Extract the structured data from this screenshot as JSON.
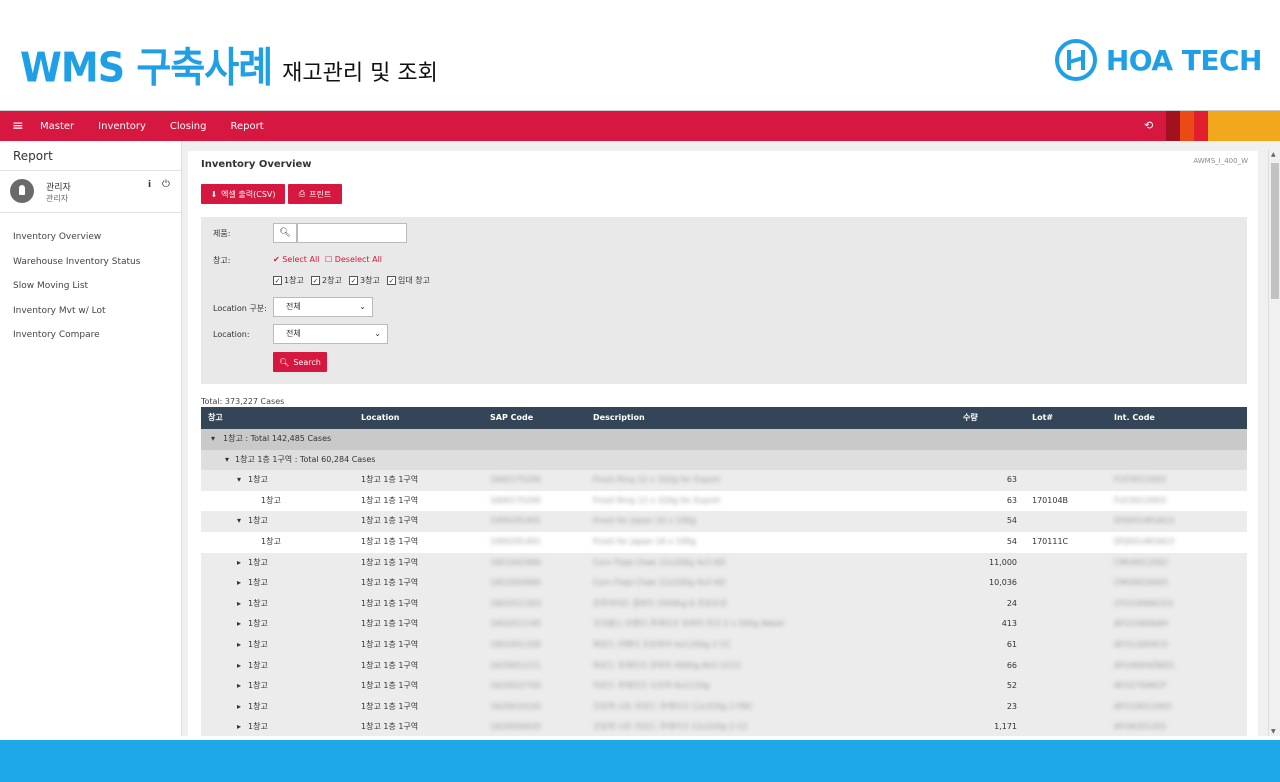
{
  "slide": {
    "title_main": "WMS 구축사례",
    "title_sub": "재고관리 및 조회",
    "logo_text": "HOA TECH",
    "accent": "#1e9fe6"
  },
  "topbar": {
    "menu_icon": "hamburger-icon",
    "nav": [
      "Master",
      "Inventory",
      "Closing",
      "Report"
    ],
    "color": "#d6173f"
  },
  "sidebar": {
    "title": "Report",
    "user_name": "관리자",
    "user_role": "관리자",
    "items": [
      "Inventory Overview",
      "Warehouse Inventory Status",
      "Slow Moving List",
      "Inventory Mvt w/ Lot",
      "Inventory Compare"
    ]
  },
  "content": {
    "title": "Inventory Overview",
    "code": "AWMS_I_400_W",
    "btn_csv": "엑셀 출력(CSV)",
    "btn_print": "프린트"
  },
  "filter": {
    "product_label": "제품:",
    "warehouse_label": "창고:",
    "select_all": "Select All",
    "deselect_all": "Deselect All",
    "warehouses": [
      "1창고",
      "2창고",
      "3창고",
      "임대 창고"
    ],
    "loc_type_label": "Location 구분:",
    "loc_type_value": "전체",
    "location_label": "Location:",
    "location_value": "전체",
    "search_btn": "Search"
  },
  "table": {
    "total": "Total: 373,227 Cases",
    "headers": [
      "창고",
      "Location",
      "SAP Code",
      "Description",
      "수량",
      "Lot#",
      "Int. Code"
    ],
    "group1": "1창고 : Total 142,485 Cases",
    "group2": "1창고 1층 1구역 : Total 60,284 Cases",
    "rows": [
      {
        "wh": "1창고",
        "loc": "1창고 1층 1구역",
        "sap": "1600175200",
        "desc": "Frosti Ring 12 x 320g for Export",
        "qty": "63",
        "lot": "",
        "int": "FUC0012003",
        "kind": "expanded"
      },
      {
        "wh": "1창고",
        "loc": "1창고 1층 1구역",
        "sap": "1600175200",
        "desc": "Frosti Ring 12 x 320g for Export",
        "qty": "63",
        "lot": "170104B",
        "int": "FUC0012003",
        "kind": "detail"
      },
      {
        "wh": "1창고",
        "loc": "1창고 1층 1구역",
        "sap": "1000291401",
        "desc": "Frosti for Japan 16 x 100g",
        "qty": "54",
        "lot": "",
        "int": "DFJ0014816G3",
        "kind": "expanded"
      },
      {
        "wh": "1창고",
        "loc": "1창고 1층 1구역",
        "sap": "1000291401",
        "desc": "Frosti for Japan 16 x 100g",
        "qty": "54",
        "lot": "170111C",
        "int": "DFJ0014816G3",
        "kind": "detail"
      },
      {
        "wh": "1창고",
        "loc": "1창고 1층 1구역",
        "sap": "1651042900",
        "desc": "Corn Flaje Chee 12x200g 4x3 KD",
        "qty": "11,000",
        "lot": "",
        "int": "CMU0012002",
        "kind": "collapsed"
      },
      {
        "wh": "1창고",
        "loc": "1창고 1층 1구역",
        "sap": "1651050900",
        "desc": "Corn Flaje Chee 12x200g 4x3 KD",
        "qty": "10,036",
        "lot": "",
        "int": "CMU0010002",
        "kind": "collapsed"
      },
      {
        "wh": "1창고",
        "loc": "1창고 1층 1구역",
        "sap": "1602011303",
        "desc": "콘푸라이트 링바이 3300kg 6 프로모션",
        "qty": "24",
        "lot": "",
        "int": "CFO10066CO3",
        "kind": "collapsed"
      },
      {
        "wh": "1창고",
        "loc": "1창고 1층 1구역",
        "sap": "1602011145",
        "desc": "코코팝스 라벤더 후레이크 포바이 미국 5 x 500g Retail",
        "qty": "413",
        "lot": "",
        "int": "AFO1S00AAH",
        "kind": "collapsed"
      },
      {
        "wh": "1창고",
        "loc": "1창고 1층 1구역",
        "sap": "1602051200",
        "desc": "파로드 라벤더 프로와커 4x1200g 2 CC",
        "qty": "61",
        "lot": "",
        "int": "AFO12004CO",
        "kind": "collapsed"
      },
      {
        "wh": "1창고",
        "loc": "1창고 1층 1구역",
        "sap": "1620051211",
        "desc": "파로드 포레이크 포바이 4000g 8x5 CCCC",
        "qty": "66",
        "lot": "",
        "int": "AFO4004ZNZO",
        "kind": "collapsed"
      },
      {
        "wh": "1창고",
        "loc": "1창고 1층 1구역",
        "sap": "1620022700",
        "desc": "라로드 후레이크 시즈마 6x1120g",
        "qty": "52",
        "lot": "",
        "int": "AFO2700KCP",
        "kind": "collapsed"
      },
      {
        "wh": "1창고",
        "loc": "1창고 1층 1구역",
        "sap": "1620010220",
        "desc": "코로박 나트 라로드 후레이크 12x320g 2 FNC",
        "qty": "23",
        "lot": "",
        "int": "AFO10012003",
        "kind": "collapsed"
      },
      {
        "wh": "1창고",
        "loc": "1창고 1층 1구역",
        "sap": "1620056020",
        "desc": "코로박 나트 라로드 후레이크 12x320g 2 CC",
        "qty": "1,171",
        "lot": "",
        "int": "AFO6201203",
        "kind": "collapsed"
      }
    ]
  }
}
